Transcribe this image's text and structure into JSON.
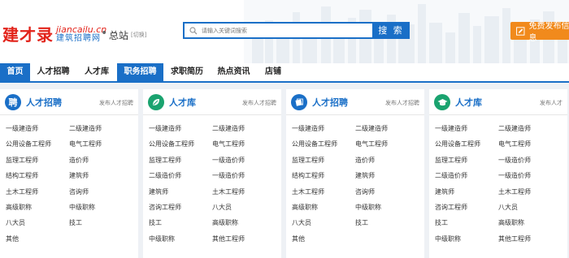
{
  "logo": {
    "main": "建才录",
    "domain": "jiancailu.cn",
    "name": "建筑招聘网"
  },
  "site": {
    "separator": "•",
    "name": "总站",
    "switch_label": "[切换]"
  },
  "search": {
    "placeholder": "请输入关键词搜索",
    "button_label": "搜 索"
  },
  "publish_button": {
    "label": "免费发布信息"
  },
  "nav": [
    {
      "label": "首页",
      "active": true
    },
    {
      "label": "人才招聘",
      "active": false
    },
    {
      "label": "人才库",
      "active": false
    },
    {
      "label": "职务招聘",
      "active": true
    },
    {
      "label": "求职简历",
      "active": false
    },
    {
      "label": "热点资讯",
      "active": false
    },
    {
      "label": "店铺",
      "active": false
    }
  ],
  "columns": [
    {
      "icon_char": "聘",
      "icon_name": "recruit-icon",
      "icon_color": "#1a6fc7",
      "title": "人才招聘",
      "link": "发布人才招聘",
      "items": [
        "一级建造师",
        "二级建造师",
        "公用设备工程师",
        "电气工程师",
        "监理工程师",
        "造价师",
        "结构工程师",
        "建筑师",
        "土木工程师",
        "咨询师",
        "高级职称",
        "中级职称",
        "八大员",
        "技工",
        "其他"
      ]
    },
    {
      "icon_char": "",
      "icon_name": "leaf-icon",
      "icon_color": "#1aa36f",
      "title": "人才库",
      "link": "发布人才招聘",
      "items": [
        "一级建造师",
        "二级建造师",
        "公用设备工程师",
        "电气工程师",
        "监理工程师",
        "一级造价师",
        "二级造价师",
        "一级造价师",
        "建筑师",
        "土木工程师",
        "咨询工程师",
        "八大员",
        "技工",
        "高级职称",
        "中级职称",
        "其他工程师"
      ]
    },
    {
      "icon_char": "",
      "icon_name": "cards-icon",
      "icon_color": "#1a6fc7",
      "title": "人才招聘",
      "link": "发布人才招聘",
      "items": [
        "一级建造师",
        "二级建造师",
        "公用设备工程师",
        "电气工程师",
        "监理工程师",
        "造价师",
        "结构工程师",
        "建筑师",
        "土木工程师",
        "咨询师",
        "高级职称",
        "中级职称",
        "八大员",
        "技工",
        "其他"
      ]
    },
    {
      "icon_char": "",
      "icon_name": "grad-cap-icon",
      "icon_color": "#1aa36f",
      "title": "人才库",
      "link": "发布人才",
      "items": [
        "一级建造师",
        "二级建造师",
        "公用设备工程师",
        "电气工程师",
        "监理工程师",
        "一级造价师",
        "二级造价师",
        "一级造价师",
        "建筑师",
        "土木工程师",
        "咨询工程师",
        "八大员",
        "技工",
        "高级职称",
        "中级职称",
        "其他工程师"
      ]
    }
  ]
}
